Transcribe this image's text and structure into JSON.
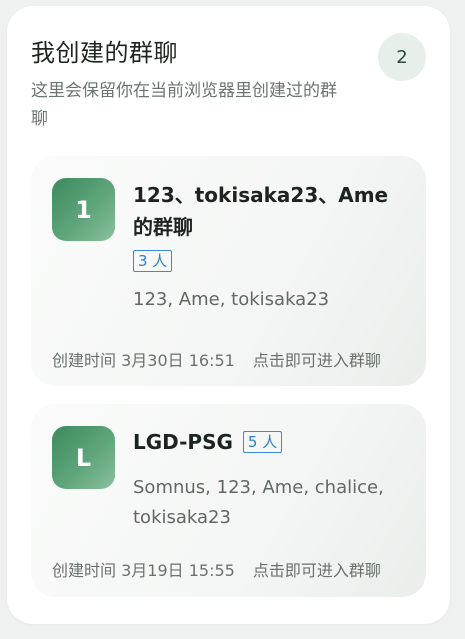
{
  "header": {
    "title": "我创建的群聊",
    "count": "2",
    "description": "这里会保留你在当前浏览器里创建过的群聊"
  },
  "groups": [
    {
      "avatar_letter": "1",
      "name": "123、tokisaka23、Ame的群聊",
      "member_count": "3 人",
      "members": "123, Ame, tokisaka23",
      "created": "创建时间 3月30日 16:51",
      "hint": "点击即可进入群聊"
    },
    {
      "avatar_letter": "L",
      "name": "LGD-PSG",
      "member_count": "5 人",
      "members": "Somnus, 123, Ame, chalice, tokisaka23",
      "created": "创建时间 3月19日 15:55",
      "hint": "点击即可进入群聊"
    }
  ],
  "colors": {
    "avatar_gradient_start": "#3d8a5e",
    "avatar_gradient_end": "#8cc09f",
    "badge_blue": "#2f7fcc",
    "count_bg": "#e6efe9"
  }
}
